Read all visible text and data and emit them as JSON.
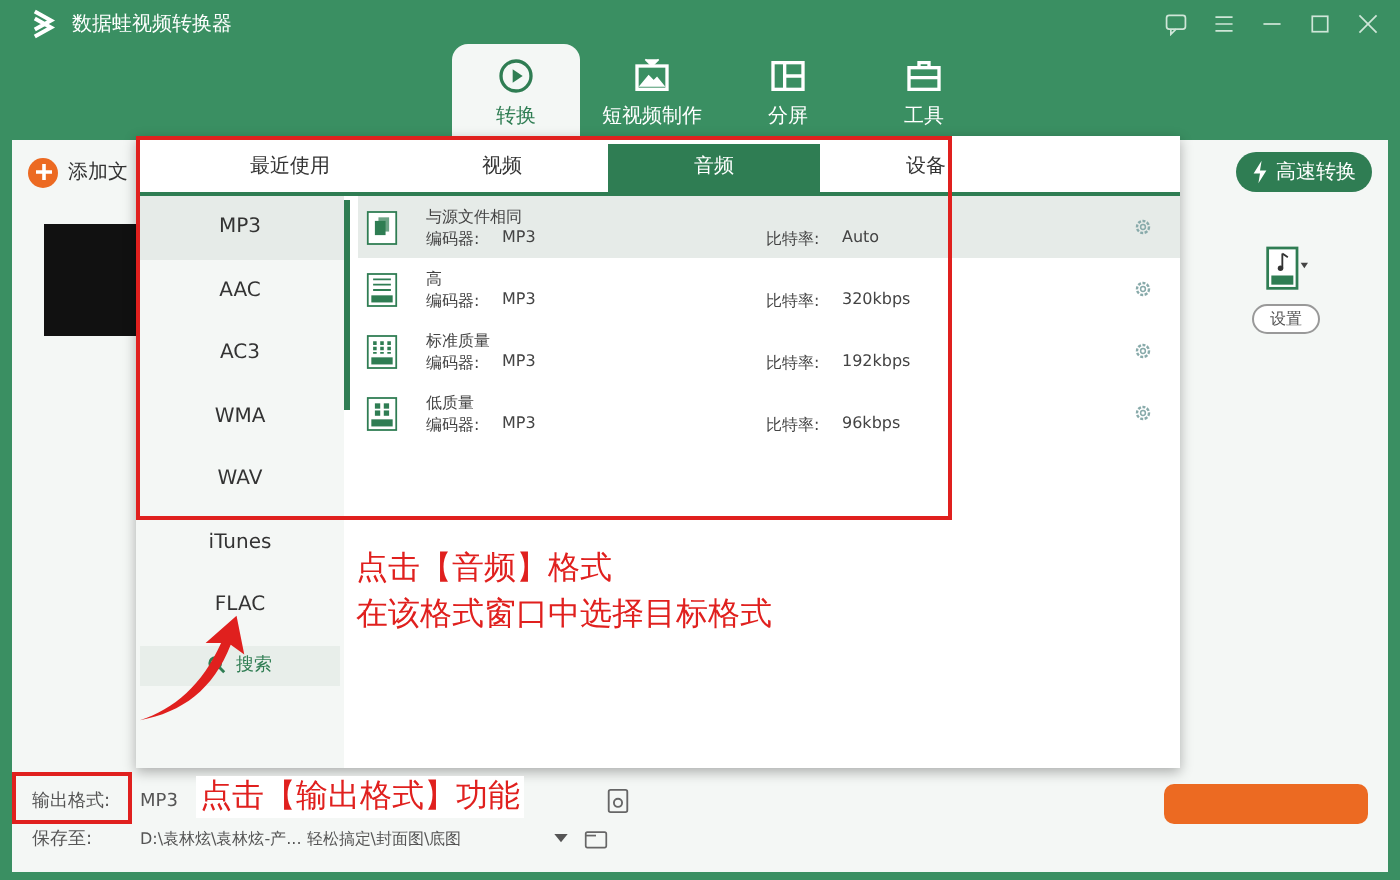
{
  "window": {
    "title": "数据蛙视频转换器"
  },
  "nav_tabs": [
    {
      "label": "转换",
      "selected": true,
      "kind": "convert"
    },
    {
      "label": "短视频制作",
      "selected": false,
      "kind": "tv"
    },
    {
      "label": "分屏",
      "selected": false,
      "kind": "split"
    },
    {
      "label": "工具",
      "selected": false,
      "kind": "toolbox"
    }
  ],
  "toolbar": {
    "add_file": "添加文",
    "fast_convert": "高速转换"
  },
  "format_popup": {
    "tabs": [
      {
        "label": "最近使用",
        "selected": false
      },
      {
        "label": "视频",
        "selected": false
      },
      {
        "label": "音频",
        "selected": true
      },
      {
        "label": "设备",
        "selected": false
      }
    ],
    "formats": [
      {
        "label": "MP3",
        "selected": true
      },
      {
        "label": "AAC",
        "selected": false
      },
      {
        "label": "AC3",
        "selected": false
      },
      {
        "label": "WMA",
        "selected": false
      },
      {
        "label": "WAV",
        "selected": false
      },
      {
        "label": "iTunes",
        "selected": false
      },
      {
        "label": "FLAC",
        "selected": false
      }
    ],
    "search": "搜索",
    "presets": [
      {
        "name": "与源文件相同",
        "encoder_label": "编码器:",
        "encoder": "MP3",
        "bitrate_label": "比特率:",
        "bitrate": "Auto",
        "selected": true,
        "kind": "copy"
      },
      {
        "name": "高",
        "encoder_label": "编码器:",
        "encoder": "MP3",
        "bitrate_label": "比特率:",
        "bitrate": "320kbps",
        "selected": false,
        "kind": "lines"
      },
      {
        "name": "标准质量",
        "encoder_label": "编码器:",
        "encoder": "MP3",
        "bitrate_label": "比特率:",
        "bitrate": "192kbps",
        "selected": false,
        "kind": "grid9"
      },
      {
        "name": "低质量",
        "encoder_label": "编码器:",
        "encoder": "MP3",
        "bitrate_label": "比特率:",
        "bitrate": "96kbps",
        "selected": false,
        "kind": "grid4"
      }
    ]
  },
  "side": {
    "settings_button": "设置"
  },
  "footer": {
    "output_label": "输出格式:",
    "output_value": "MP3",
    "save_label": "保存至:",
    "save_path": "D:\\袁林炫\\袁林炫-产...  轻松搞定\\封面图\\底图"
  },
  "annotations": {
    "popup_note": [
      "点击【音频】格式",
      "在该格式窗口中选择目标格式"
    ],
    "footer_note": "点击【输出格式】功能"
  }
}
